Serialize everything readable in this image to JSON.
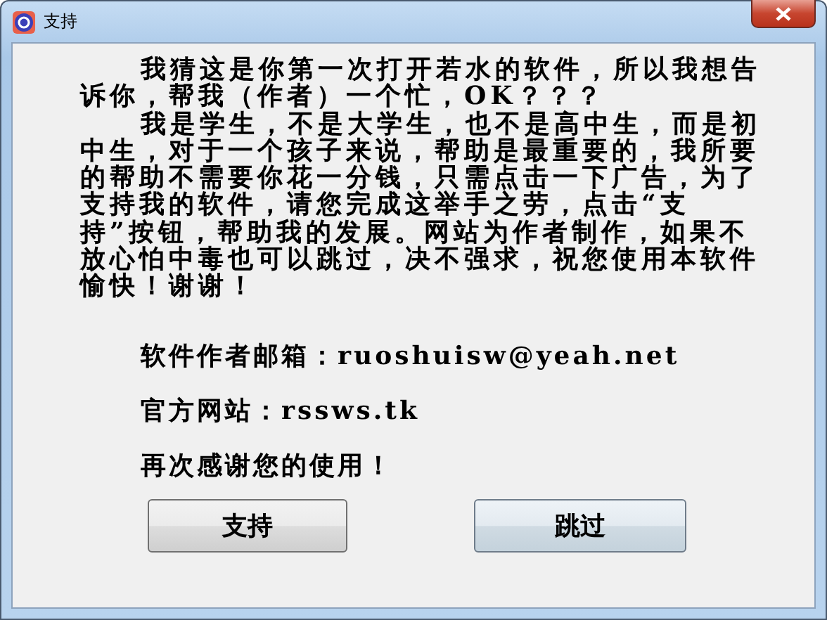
{
  "window": {
    "title": "支持"
  },
  "paragraphs": [
    "我猜这是你第一次打开若水的软件，所以我想告诉你，帮我（作者）一个忙，OK？？？",
    "我是学生，不是大学生，也不是高中生，而是初中生，对于一个孩子来说，帮助是最重要的，我所要的帮助不需要你花一分钱，只需点击一下广告，为了支持我的软件，请您完成这举手之劳，点击“支持”按钮，帮助我的发展。网站为作者制作，如果不放心怕中毒也可以跳过，决不强求，祝您使用本软件愉快！谢谢！"
  ],
  "lines": [
    "软件作者邮箱：ruoshuisw@yeah.net",
    "官方网站：rssws.tk",
    "再次感谢您的使用！"
  ],
  "buttons": [
    {
      "label": "支持",
      "default": false
    },
    {
      "label": "跳过",
      "default": true
    }
  ]
}
